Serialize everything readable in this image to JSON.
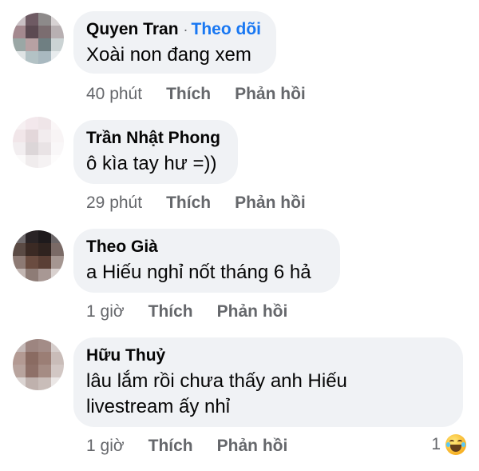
{
  "comments": [
    {
      "author": "Quyen Tran",
      "follow_sep": "·",
      "follow_label": "Theo dõi",
      "text": "Xoài non đang xem",
      "time": "40 phút",
      "like_label": "Thích",
      "reply_label": "Phản hồi"
    },
    {
      "author": "Trần Nhật Phong",
      "text": "ô kìa tay hư =))",
      "time": "29 phút",
      "like_label": "Thích",
      "reply_label": "Phản hồi"
    },
    {
      "author": "Theo Già",
      "text": "a Hiếu nghỉ nốt tháng 6 hả",
      "time": "1 giờ",
      "like_label": "Thích",
      "reply_label": "Phản hồi"
    },
    {
      "author": "Hữu Thuỷ",
      "text_line1": "lâu lắm rồi chưa thấy anh Hiếu",
      "text_line2": "livestream ấy nhỉ",
      "time": "1 giờ",
      "like_label": "Thích",
      "reply_label": "Phản hồi",
      "reaction_count": "1",
      "reaction_icon": "haha-emoji-icon"
    }
  ],
  "colors": {
    "bubble": "#f0f2f5",
    "link": "#1877f2",
    "meta": "#65676b",
    "text": "#050505"
  }
}
